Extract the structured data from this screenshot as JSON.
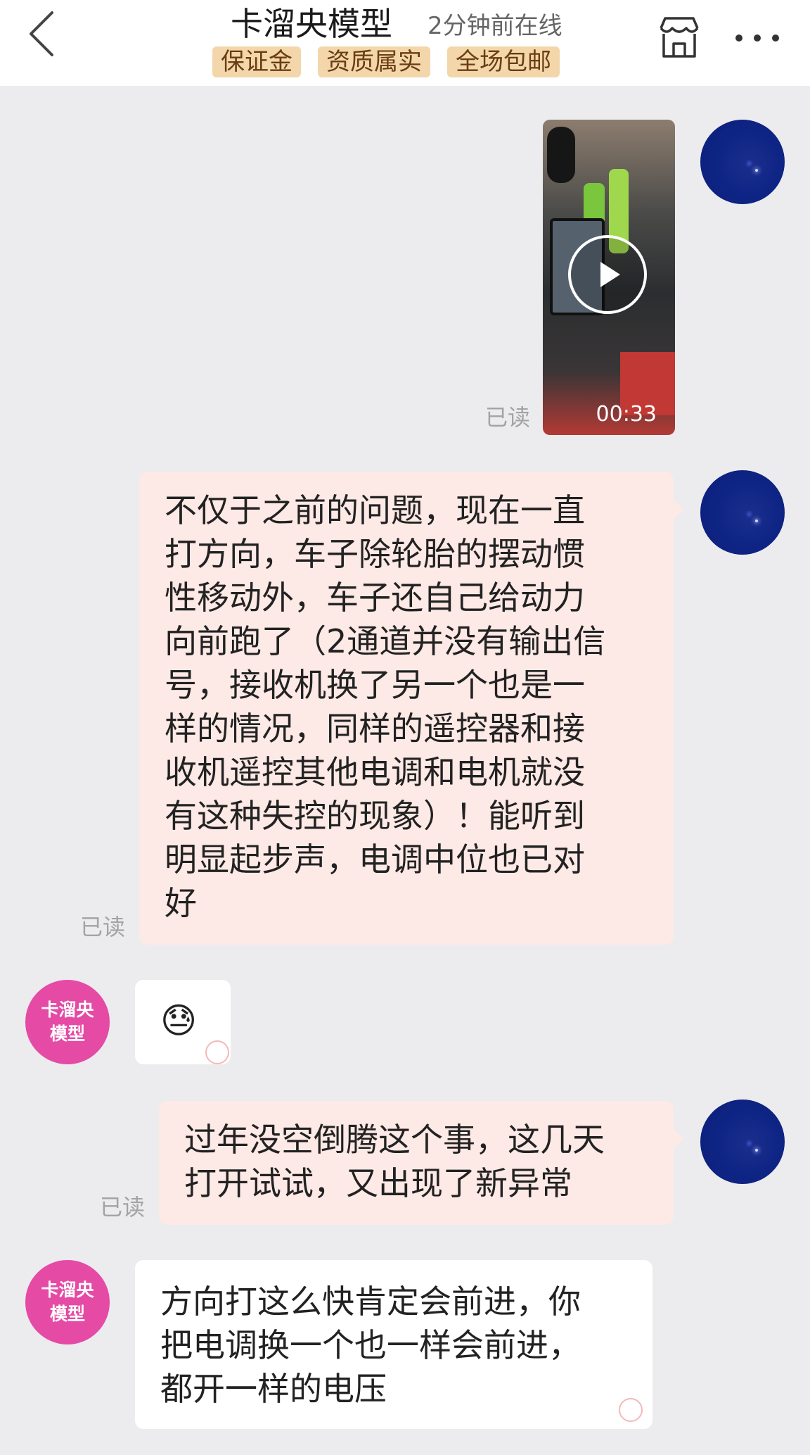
{
  "header": {
    "title": "卡溜央模型",
    "status": "2分钟前在线",
    "badges": [
      "保证金",
      "资质属实",
      "全场包邮"
    ]
  },
  "icons": {
    "back": "back-arrow-icon",
    "shop": "shop-icon",
    "more": "more-icon",
    "play": "play-icon"
  },
  "shop_avatar": {
    "line1": "卡溜央",
    "line2": "模型",
    "color": "#e54aa5"
  },
  "messages": [
    {
      "sender": "me",
      "type": "video",
      "duration": "00:33",
      "read": "已读"
    },
    {
      "sender": "me",
      "type": "text",
      "read": "已读",
      "lines": [
        "不仅于之前的问题，现在一直",
        "打方向，车子除轮胎的摆动惯",
        "性移动外，车子还自己给动力",
        "向前跑了（2通道并没有输出信",
        "号，接收机换了另一个也是一",
        "样的情况，同样的遥控器和接",
        "收机遥控其他电调和电机就没",
        "有这种失控的现象）！能听到",
        "明显起步声，电调中位也已对",
        "好"
      ]
    },
    {
      "sender": "shop",
      "type": "emoji",
      "emoji": "😓"
    },
    {
      "sender": "me",
      "type": "text",
      "read": "已读",
      "lines": [
        "过年没空倒腾这个事，这几天",
        "打开试试，又出现了新异常"
      ]
    },
    {
      "sender": "shop",
      "type": "text",
      "lines": [
        "方向打这么快肯定会前进，你",
        "把电调换一个也一样会前进，",
        "都开一样的电压"
      ]
    }
  ],
  "colors": {
    "background": "#ececef",
    "my_bubble": "#fde9e5",
    "shop_bubble": "#ffffff",
    "badge_bg": "#f3d7ab",
    "badge_text": "#6a3d12",
    "my_avatar": "#0f2585"
  }
}
